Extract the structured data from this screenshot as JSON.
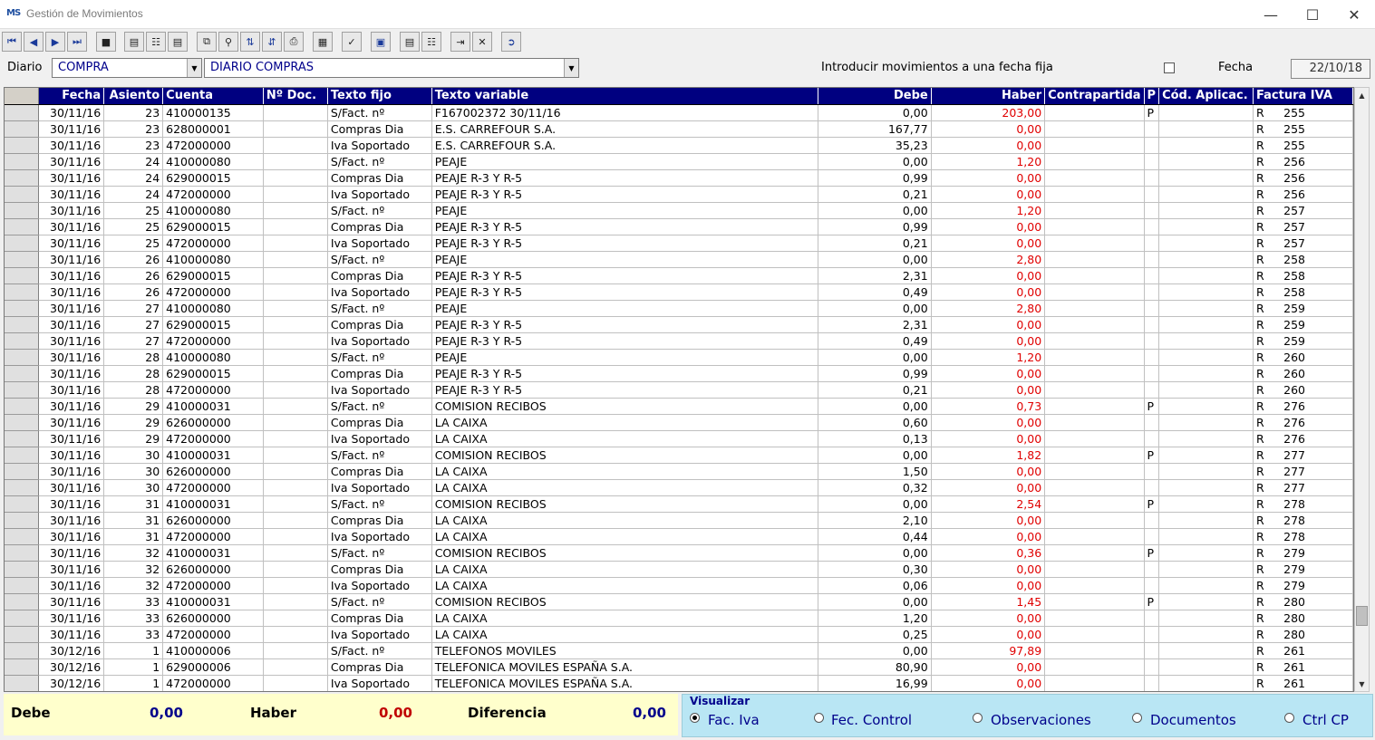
{
  "window": {
    "title": "Gestión de Movimientos",
    "icon_text": "MS"
  },
  "toolbar": {
    "buttons": [
      "first-record-icon",
      "prev-record-icon",
      "next-record-icon",
      "last-record-icon",
      "blank-icon",
      "find-icon",
      "book-icon",
      "ledger-icon",
      "copy-icon",
      "zoom-icon",
      "sort-asc-icon",
      "sort-desc-icon",
      "print-icon",
      "calculator-icon",
      "check-icon",
      "monitor-icon",
      "register-icon",
      "journal-icon",
      "import-icon",
      "close-x-icon",
      "exit-icon"
    ]
  },
  "filters": {
    "diario_label": "Diario",
    "diario_code": "COMPRA",
    "diario_name": "DIARIO COMPRAS",
    "fixed_date_label": "Introducir movimientos a una fecha fija",
    "fecha_label": "Fecha",
    "fecha_value": "22/10/18"
  },
  "grid": {
    "columns": [
      "",
      "Fecha",
      "Asiento",
      "Cuenta",
      "Nº Doc.",
      "Texto fijo",
      "Texto variable",
      "Debe",
      "Haber",
      "Contrapartida",
      "P",
      "Cód. Aplicac.",
      "Factura IVA"
    ],
    "rows": [
      [
        "30/11/16",
        "23",
        "410000135",
        "",
        "S/Fact. nº",
        "F167002372  30/11/16",
        "0,00",
        "203,00",
        "",
        "P",
        "",
        "R",
        "255"
      ],
      [
        "30/11/16",
        "23",
        "628000001",
        "",
        "Compras Dia",
        "E.S. CARREFOUR S.A.",
        "167,77",
        "0,00",
        "",
        "",
        "",
        "R",
        "255"
      ],
      [
        "30/11/16",
        "23",
        "472000000",
        "",
        "Iva Soportado",
        "E.S. CARREFOUR S.A.",
        "35,23",
        "0,00",
        "",
        "",
        "",
        "R",
        "255"
      ],
      [
        "30/11/16",
        "24",
        "410000080",
        "",
        "S/Fact. nº",
        "PEAJE",
        "0,00",
        "1,20",
        "",
        "",
        "",
        "R",
        "256"
      ],
      [
        "30/11/16",
        "24",
        "629000015",
        "",
        "Compras Dia",
        "PEAJE R-3 Y R-5",
        "0,99",
        "0,00",
        "",
        "",
        "",
        "R",
        "256"
      ],
      [
        "30/11/16",
        "24",
        "472000000",
        "",
        "Iva Soportado",
        "PEAJE R-3 Y R-5",
        "0,21",
        "0,00",
        "",
        "",
        "",
        "R",
        "256"
      ],
      [
        "30/11/16",
        "25",
        "410000080",
        "",
        "S/Fact. nº",
        "PEAJE",
        "0,00",
        "1,20",
        "",
        "",
        "",
        "R",
        "257"
      ],
      [
        "30/11/16",
        "25",
        "629000015",
        "",
        "Compras Dia",
        "PEAJE R-3 Y R-5",
        "0,99",
        "0,00",
        "",
        "",
        "",
        "R",
        "257"
      ],
      [
        "30/11/16",
        "25",
        "472000000",
        "",
        "Iva Soportado",
        "PEAJE R-3 Y R-5",
        "0,21",
        "0,00",
        "",
        "",
        "",
        "R",
        "257"
      ],
      [
        "30/11/16",
        "26",
        "410000080",
        "",
        "S/Fact. nº",
        "PEAJE",
        "0,00",
        "2,80",
        "",
        "",
        "",
        "R",
        "258"
      ],
      [
        "30/11/16",
        "26",
        "629000015",
        "",
        "Compras Dia",
        "PEAJE R-3 Y R-5",
        "2,31",
        "0,00",
        "",
        "",
        "",
        "R",
        "258"
      ],
      [
        "30/11/16",
        "26",
        "472000000",
        "",
        "Iva Soportado",
        "PEAJE R-3 Y R-5",
        "0,49",
        "0,00",
        "",
        "",
        "",
        "R",
        "258"
      ],
      [
        "30/11/16",
        "27",
        "410000080",
        "",
        "S/Fact. nº",
        "PEAJE",
        "0,00",
        "2,80",
        "",
        "",
        "",
        "R",
        "259"
      ],
      [
        "30/11/16",
        "27",
        "629000015",
        "",
        "Compras Dia",
        "PEAJE R-3 Y R-5",
        "2,31",
        "0,00",
        "",
        "",
        "",
        "R",
        "259"
      ],
      [
        "30/11/16",
        "27",
        "472000000",
        "",
        "Iva Soportado",
        "PEAJE R-3 Y R-5",
        "0,49",
        "0,00",
        "",
        "",
        "",
        "R",
        "259"
      ],
      [
        "30/11/16",
        "28",
        "410000080",
        "",
        "S/Fact. nº",
        "PEAJE",
        "0,00",
        "1,20",
        "",
        "",
        "",
        "R",
        "260"
      ],
      [
        "30/11/16",
        "28",
        "629000015",
        "",
        "Compras Dia",
        "PEAJE R-3 Y R-5",
        "0,99",
        "0,00",
        "",
        "",
        "",
        "R",
        "260"
      ],
      [
        "30/11/16",
        "28",
        "472000000",
        "",
        "Iva Soportado",
        "PEAJE R-3 Y R-5",
        "0,21",
        "0,00",
        "",
        "",
        "",
        "R",
        "260"
      ],
      [
        "30/11/16",
        "29",
        "410000031",
        "",
        "S/Fact. nº",
        "COMISION RECIBOS",
        "0,00",
        "0,73",
        "",
        "P",
        "",
        "R",
        "276"
      ],
      [
        "30/11/16",
        "29",
        "626000000",
        "",
        "Compras Dia",
        "LA CAIXA",
        "0,60",
        "0,00",
        "",
        "",
        "",
        "R",
        "276"
      ],
      [
        "30/11/16",
        "29",
        "472000000",
        "",
        "Iva Soportado",
        "LA CAIXA",
        "0,13",
        "0,00",
        "",
        "",
        "",
        "R",
        "276"
      ],
      [
        "30/11/16",
        "30",
        "410000031",
        "",
        "S/Fact. nº",
        "COMISION RECIBOS",
        "0,00",
        "1,82",
        "",
        "P",
        "",
        "R",
        "277"
      ],
      [
        "30/11/16",
        "30",
        "626000000",
        "",
        "Compras Dia",
        "LA CAIXA",
        "1,50",
        "0,00",
        "",
        "",
        "",
        "R",
        "277"
      ],
      [
        "30/11/16",
        "30",
        "472000000",
        "",
        "Iva Soportado",
        "LA CAIXA",
        "0,32",
        "0,00",
        "",
        "",
        "",
        "R",
        "277"
      ],
      [
        "30/11/16",
        "31",
        "410000031",
        "",
        "S/Fact. nº",
        "COMISION RECIBOS",
        "0,00",
        "2,54",
        "",
        "P",
        "",
        "R",
        "278"
      ],
      [
        "30/11/16",
        "31",
        "626000000",
        "",
        "Compras Dia",
        "LA CAIXA",
        "2,10",
        "0,00",
        "",
        "",
        "",
        "R",
        "278"
      ],
      [
        "30/11/16",
        "31",
        "472000000",
        "",
        "Iva Soportado",
        "LA CAIXA",
        "0,44",
        "0,00",
        "",
        "",
        "",
        "R",
        "278"
      ],
      [
        "30/11/16",
        "32",
        "410000031",
        "",
        "S/Fact. nº",
        "COMISION RECIBOS",
        "0,00",
        "0,36",
        "",
        "P",
        "",
        "R",
        "279"
      ],
      [
        "30/11/16",
        "32",
        "626000000",
        "",
        "Compras Dia",
        "LA CAIXA",
        "0,30",
        "0,00",
        "",
        "",
        "",
        "R",
        "279"
      ],
      [
        "30/11/16",
        "32",
        "472000000",
        "",
        "Iva Soportado",
        "LA CAIXA",
        "0,06",
        "0,00",
        "",
        "",
        "",
        "R",
        "279"
      ],
      [
        "30/11/16",
        "33",
        "410000031",
        "",
        "S/Fact. nº",
        "COMISION RECIBOS",
        "0,00",
        "1,45",
        "",
        "P",
        "",
        "R",
        "280"
      ],
      [
        "30/11/16",
        "33",
        "626000000",
        "",
        "Compras Dia",
        "LA CAIXA",
        "1,20",
        "0,00",
        "",
        "",
        "",
        "R",
        "280"
      ],
      [
        "30/11/16",
        "33",
        "472000000",
        "",
        "Iva Soportado",
        "LA CAIXA",
        "0,25",
        "0,00",
        "",
        "",
        "",
        "R",
        "280"
      ],
      [
        "30/12/16",
        "1",
        "410000006",
        "",
        "S/Fact. nº",
        "TELEFONOS MOVILES",
        "0,00",
        "97,89",
        "",
        "",
        "",
        "R",
        "261"
      ],
      [
        "30/12/16",
        "1",
        "629000006",
        "",
        "Compras Dia",
        "TELEFONICA MOVILES ESPAÑA S.A.",
        "80,90",
        "0,00",
        "",
        "",
        "",
        "R",
        "261"
      ],
      [
        "30/12/16",
        "1",
        "472000000",
        "",
        "Iva Soportado",
        "TELEFONICA MOVILES ESPAÑA S.A.",
        "16,99",
        "0,00",
        "",
        "",
        "",
        "R",
        "261"
      ]
    ]
  },
  "totals": {
    "debe_label": "Debe",
    "debe_value": "0,00",
    "haber_label": "Haber",
    "haber_value": "0,00",
    "diferencia_label": "Diferencia",
    "diferencia_value": "0,00"
  },
  "visualizar": {
    "title": "Visualizar",
    "options": [
      "Fac. Iva",
      "Fec. Control",
      "Observaciones",
      "Documentos",
      "Ctrl CP"
    ],
    "selected": "Fac. Iva"
  },
  "colors": {
    "header_bg": "#000080",
    "haber_text": "#e00000",
    "totals_bg": "#ffffcc",
    "visualizar_bg": "#b9e6f4"
  }
}
